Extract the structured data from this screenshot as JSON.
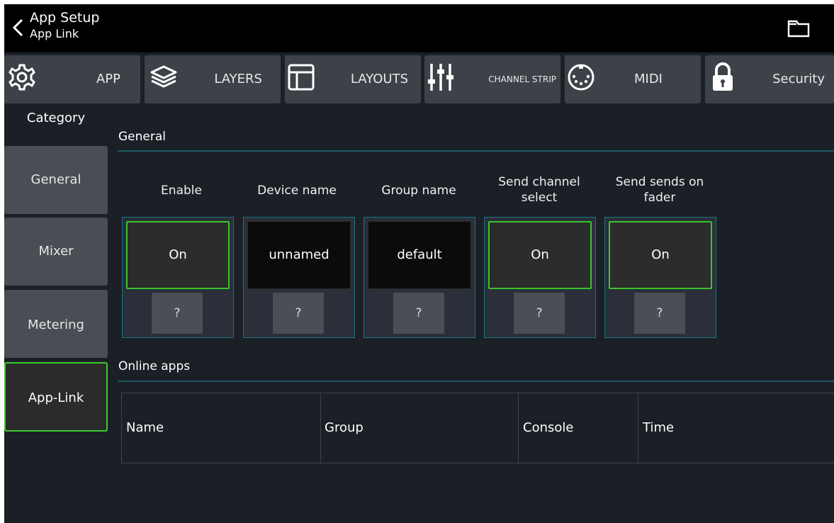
{
  "header": {
    "title": "App Setup",
    "subtitle": "App Link",
    "back_icon": "chevron-left-icon",
    "folder_icon": "folder-icon"
  },
  "tabs": [
    {
      "label": "APP",
      "icon": "gear-icon"
    },
    {
      "label": "LAYERS",
      "icon": "layers-icon"
    },
    {
      "label": "LAYOUTS",
      "icon": "layout-icon"
    },
    {
      "label": "CHANNEL STRIP",
      "icon": "faders-icon"
    },
    {
      "label": "MIDI",
      "icon": "midi-connector-icon"
    },
    {
      "label": "Security",
      "icon": "lock-icon"
    }
  ],
  "sidebar": {
    "heading": "Category",
    "items": [
      {
        "label": "General",
        "active": false
      },
      {
        "label": "Mixer",
        "active": false
      },
      {
        "label": "Metering",
        "active": false
      },
      {
        "label": "App-Link",
        "active": true
      }
    ]
  },
  "general": {
    "heading": "General",
    "settings": [
      {
        "label": "Enable",
        "value": "On",
        "help": "?"
      },
      {
        "label": "Device name",
        "value": "unnamed",
        "help": "?"
      },
      {
        "label": "Group name",
        "value": "default",
        "help": "?"
      },
      {
        "label": "Send channel select",
        "value": "On",
        "help": "?"
      },
      {
        "label": "Send sends on fader",
        "value": "On",
        "help": "?"
      }
    ]
  },
  "online_apps": {
    "heading": "Online apps",
    "columns": [
      "Name",
      "Group",
      "Console",
      "Time"
    ],
    "rows": []
  },
  "colors": {
    "background": "#1b1f26",
    "active_border": "#3ccb2c",
    "card_border": "#197580",
    "button": "#4a4d53"
  }
}
